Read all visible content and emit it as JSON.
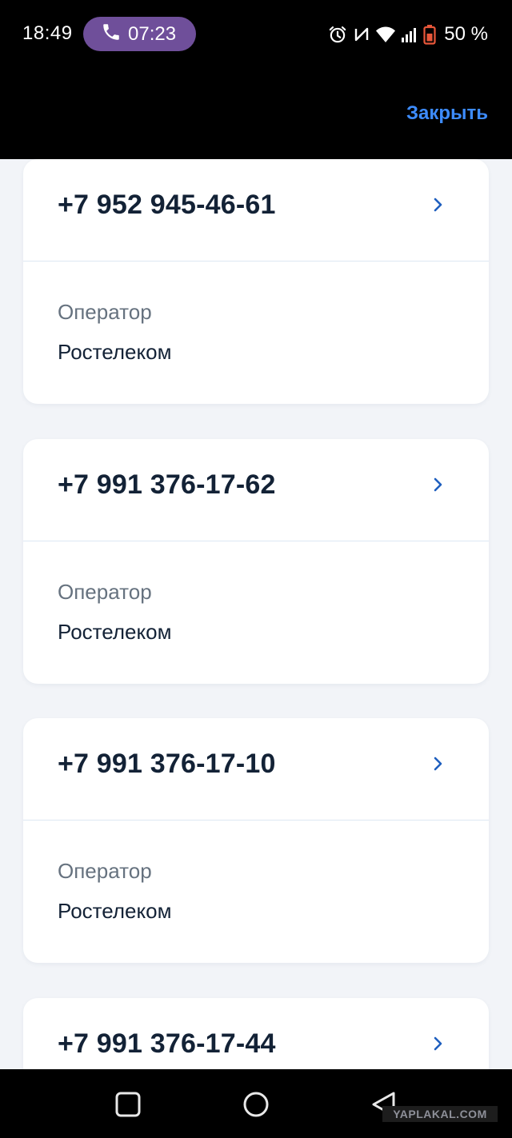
{
  "status_bar": {
    "time": "18:49",
    "call_duration": "07:23",
    "battery_percent": "50 %",
    "icons": [
      "alarm-icon",
      "nfc-icon",
      "wifi-icon",
      "signal-icon",
      "battery-icon"
    ]
  },
  "header": {
    "close_label": "Закрыть"
  },
  "cards": [
    {
      "phone": "+7 952 945-46-61",
      "operator_label": "Оператор",
      "operator_value": "Ростелеком"
    },
    {
      "phone": "+7 991 376-17-62",
      "operator_label": "Оператор",
      "operator_value": "Ростелеком"
    },
    {
      "phone": "+7 991 376-17-10",
      "operator_label": "Оператор",
      "operator_value": "Ростелеком"
    },
    {
      "phone": "+7 991 376-17-44"
    }
  ],
  "nav": {
    "buttons": [
      "recents-icon",
      "home-icon",
      "back-icon"
    ]
  },
  "watermark": "YAPLAKAL.COM",
  "colors": {
    "accent": "#3d8cff",
    "call_pill": "#6f4f9a",
    "text_primary": "#132236",
    "text_secondary": "#66727f",
    "chevron": "#1f5fbf",
    "background": "#f2f4f8"
  }
}
